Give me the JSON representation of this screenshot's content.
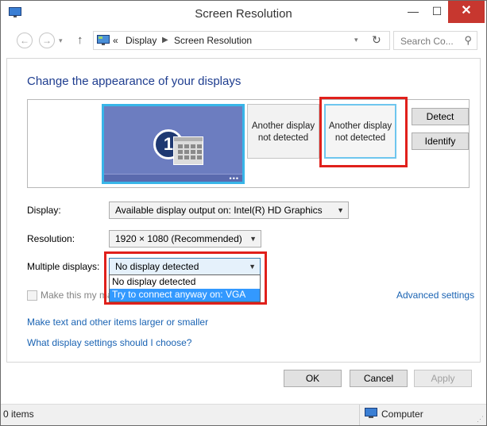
{
  "window": {
    "title": "Screen Resolution"
  },
  "titlebar": {
    "minimize": "—",
    "maximize": "☐",
    "close": "✕"
  },
  "address": {
    "breadcrumb_overflow": "«",
    "crumbs": [
      "Display",
      "Screen Resolution"
    ],
    "search_placeholder": "Search Co..."
  },
  "content": {
    "heading": "Change the appearance of your displays",
    "monitors": {
      "primary_number": "1",
      "other1_line1": "Another display",
      "other1_line2": "not detected",
      "other2_line1": "Another display",
      "other2_line2": "not detected"
    },
    "detect_label": "Detect",
    "identify_label": "Identify",
    "display_label": "Display:",
    "display_value": "Available display output on: Intel(R) HD Graphics",
    "resolution_label": "Resolution:",
    "resolution_value": "1920 × 1080 (Recommended)",
    "multiple_label": "Multiple displays:",
    "multiple_value": "No display detected",
    "multiple_options": [
      "No display detected",
      "Try to connect anyway on: VGA"
    ],
    "make_main_label": "Make this my ma",
    "advanced_link": "Advanced settings",
    "link_text_size": "Make text and other items larger or smaller",
    "link_which_settings": "What display settings should I choose?"
  },
  "buttons": {
    "ok": "OK",
    "cancel": "Cancel",
    "apply": "Apply"
  },
  "status": {
    "items": "0 items",
    "location": "Computer"
  },
  "colors": {
    "highlight_box": "#e0201b",
    "link": "#1a63b3",
    "heading": "#1e3d8f",
    "selected": "#3399ff"
  }
}
